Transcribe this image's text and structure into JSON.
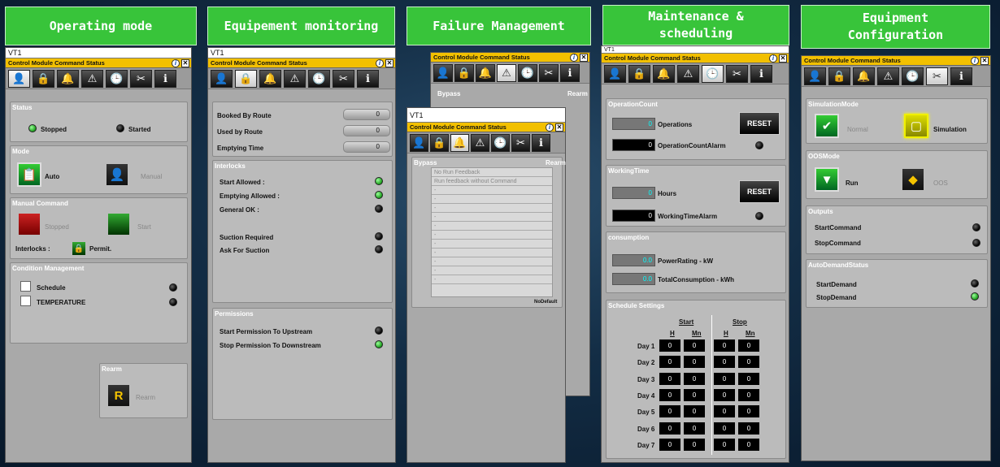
{
  "headers": {
    "p1": "Operating mode",
    "p2": "Equipement monitoring",
    "p3": "Failure Management",
    "p4": "Maintenance &\nscheduling",
    "p5": "Equipment\nConfiguration"
  },
  "common": {
    "vt": "VT1",
    "bar": "Control Module Command Status",
    "info": "i",
    "close": "✕"
  },
  "tabicons": [
    "👤",
    "🔒",
    "🔔",
    "⚠",
    "🕒",
    "✂",
    "ℹ"
  ],
  "p1": {
    "status_t": "Status",
    "stopped": "Stopped",
    "started": "Started",
    "mode_t": "Mode",
    "auto": "Auto",
    "manual": "Manual",
    "mc_t": "Manual Command",
    "stop": "Stopped",
    "start": "Start",
    "interlocks": "Interlocks :",
    "permit": "Permit.",
    "cm_t": "Condition Management",
    "schedule": "Schedule",
    "temperature": "TEMPERATURE",
    "rearm_t": "Rearm",
    "rearm": "Rearm"
  },
  "p2": {
    "booked": "Booked By Route",
    "used": "Used by Route",
    "empty": "Emptying Time",
    "v0": "0",
    "v1": "0",
    "v2": "0",
    "il_t": "Interlocks",
    "sa": "Start Allowed :",
    "ea": "Emptying Allowed :",
    "gok": "General OK :",
    "sr": "Suction Required",
    "afs": "Ask For Suction",
    "perm_t": "Permissions",
    "psu": "Start Permission To Upstream",
    "psd": "Stop Permission To Downstream"
  },
  "p3": {
    "bypass": "Bypass",
    "rearm": "Rearm",
    "r1": "No Run Feedback",
    "r2": "Run feedback without Command",
    "nodef": "NoDefault",
    "dash": "-"
  },
  "p4": {
    "oc_t": "OperationCount",
    "ops": "Operations",
    "opalarm": "OperationCountAlarm",
    "ops_v": "0",
    "opsalarm_v": "0",
    "reset": "RESET",
    "wt_t": "WorkingTime",
    "hours": "Hours",
    "hours_v": "0",
    "wtalarm": "WorkingTimeAlarm",
    "wtalarm_v": "0",
    "cons_t": "consumption",
    "power": "PowerRating - kW",
    "power_v": "0.0",
    "total": "TotalConsumption - kWh",
    "total_v": "0.0",
    "ss_t": "Schedule Settings",
    "start": "Start",
    "stop": "Stop",
    "h": "H",
    "mn": "Mn",
    "days": [
      "Day 1",
      "Day 2",
      "Day 3",
      "Day 4",
      "Day 5",
      "Day 6",
      "Day 7"
    ],
    "cell": "0"
  },
  "p5": {
    "sim_t": "SimulationMode",
    "normal": "Normal",
    "simulation": "Simulation",
    "oos_t": "OOSMode",
    "run": "Run",
    "oos": "OOS",
    "out_t": "Outputs",
    "sc": "StartCommand",
    "stc": "StopCommand",
    "ad_t": "AutoDemandStatus",
    "sd": "StartDemand",
    "std": "StopDemand"
  }
}
